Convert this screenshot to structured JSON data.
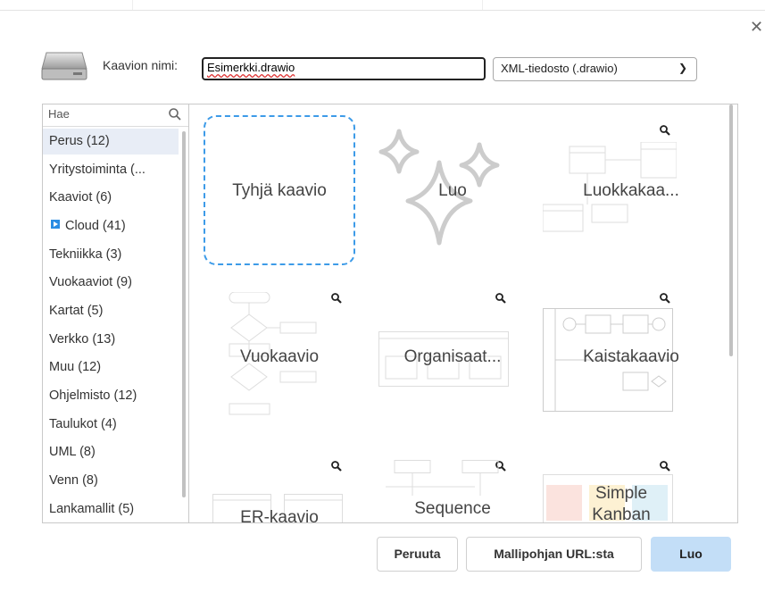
{
  "dialog": {
    "name_label": "Kaavion nimi:",
    "filename": "Esimerkki.drawio",
    "format_selected": "XML-tiedosto (.drawio)",
    "close_icon": "close-icon"
  },
  "search": {
    "placeholder": "Hae"
  },
  "categories": [
    {
      "label": "Perus (12)",
      "selected": true
    },
    {
      "label": "Yritystoiminta (..."
    },
    {
      "label": "Kaaviot (6)"
    },
    {
      "label": "Cloud (41)",
      "icon": "cloud-icon"
    },
    {
      "label": "Tekniikka (3)"
    },
    {
      "label": "Vuokaaviot (9)"
    },
    {
      "label": "Kartat (5)"
    },
    {
      "label": "Verkko (13)"
    },
    {
      "label": "Muu (12)"
    },
    {
      "label": "Ohjelmisto (12)"
    },
    {
      "label": "Taulukot (4)"
    },
    {
      "label": "UML (8)"
    },
    {
      "label": "Venn (8)"
    },
    {
      "label": "Lankamallit (5)"
    }
  ],
  "templates": [
    {
      "label": "Tyhjä kaavio"
    },
    {
      "label": "Luo"
    },
    {
      "label": "Luokkakaa..."
    },
    {
      "label": "Vuokaavio"
    },
    {
      "label": "Organisaat..."
    },
    {
      "label": "Kaistakaavio"
    },
    {
      "label": "ER-kaavio"
    },
    {
      "label": "Sequence"
    },
    {
      "label": "Simple Kanban"
    }
  ],
  "buttons": {
    "cancel": "Peruuta",
    "from_url": "Mallipohjan URL:sta",
    "create": "Luo"
  },
  "colors": {
    "accent": "#3d9be8",
    "primary_button": "#c3def7"
  }
}
